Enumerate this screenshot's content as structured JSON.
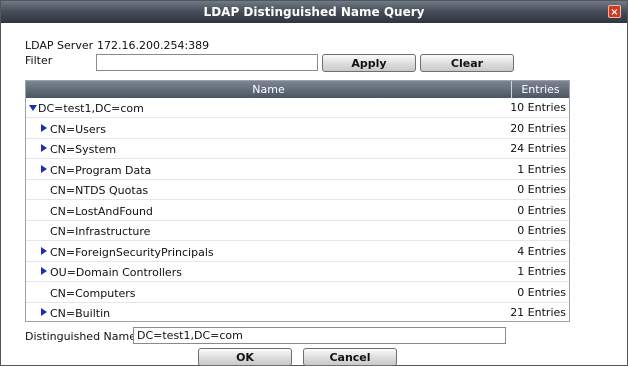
{
  "dialog": {
    "title": "LDAP Distinguished Name Query",
    "close_glyph": "×"
  },
  "server": {
    "label": "LDAP Server",
    "value": "172.16.200.254:389"
  },
  "filter": {
    "label": "Filter",
    "value": ""
  },
  "buttons": {
    "apply": "Apply",
    "clear": "Clear",
    "ok": "OK",
    "cancel": "Cancel"
  },
  "table": {
    "columns": [
      "Name",
      "Entries"
    ],
    "rows": [
      {
        "name": "DC=test1,DC=com",
        "entries": "10 Entries",
        "expander": "expanded"
      },
      {
        "name": "CN=Users",
        "entries": "20 Entries",
        "expander": "collapsed"
      },
      {
        "name": "CN=System",
        "entries": "24 Entries",
        "expander": "collapsed"
      },
      {
        "name": "CN=Program Data",
        "entries": "1 Entries",
        "expander": "collapsed"
      },
      {
        "name": "CN=NTDS Quotas",
        "entries": "0 Entries",
        "expander": "none"
      },
      {
        "name": "CN=LostAndFound",
        "entries": "0 Entries",
        "expander": "none"
      },
      {
        "name": "CN=Infrastructure",
        "entries": "0 Entries",
        "expander": "none"
      },
      {
        "name": "CN=ForeignSecurityPrincipals",
        "entries": "4 Entries",
        "expander": "collapsed"
      },
      {
        "name": "OU=Domain Controllers",
        "entries": "1 Entries",
        "expander": "collapsed"
      },
      {
        "name": "CN=Computers",
        "entries": "0 Entries",
        "expander": "none"
      },
      {
        "name": "CN=Builtin",
        "entries": "21 Entries",
        "expander": "collapsed"
      }
    ]
  },
  "distinguished_name": {
    "label": "Distinguished Name:",
    "value": "DC=test1,DC=com"
  }
}
